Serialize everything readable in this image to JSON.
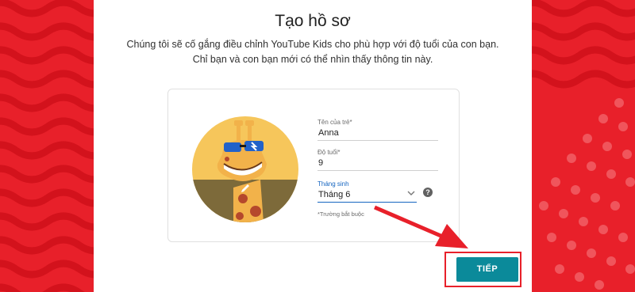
{
  "page": {
    "title": "Tạo hồ sơ",
    "subtitle_line1": "Chúng tôi sẽ cố gắng điều chỉnh YouTube Kids cho phù hợp với độ tuổi của con bạn.",
    "subtitle_line2": "Chỉ bạn và con bạn mới có thể nhìn thấy thông tin này."
  },
  "form": {
    "name": {
      "label": "Tên của trẻ*",
      "value": "Anna"
    },
    "age": {
      "label": "Độ tuổi*",
      "value": "9"
    },
    "month": {
      "label": "Tháng sinh",
      "value": "Tháng 6"
    },
    "required_note": "*Trường bắt buộc",
    "help_glyph": "?"
  },
  "actions": {
    "next_label": "TIẾP"
  },
  "colors": {
    "brand_red": "#e8202a",
    "button_teal": "#0b8a9a",
    "focus_blue": "#1565c0"
  },
  "icons": [
    "pencil-icon",
    "chevron-down-icon",
    "help-icon",
    "giraffe-avatar"
  ]
}
